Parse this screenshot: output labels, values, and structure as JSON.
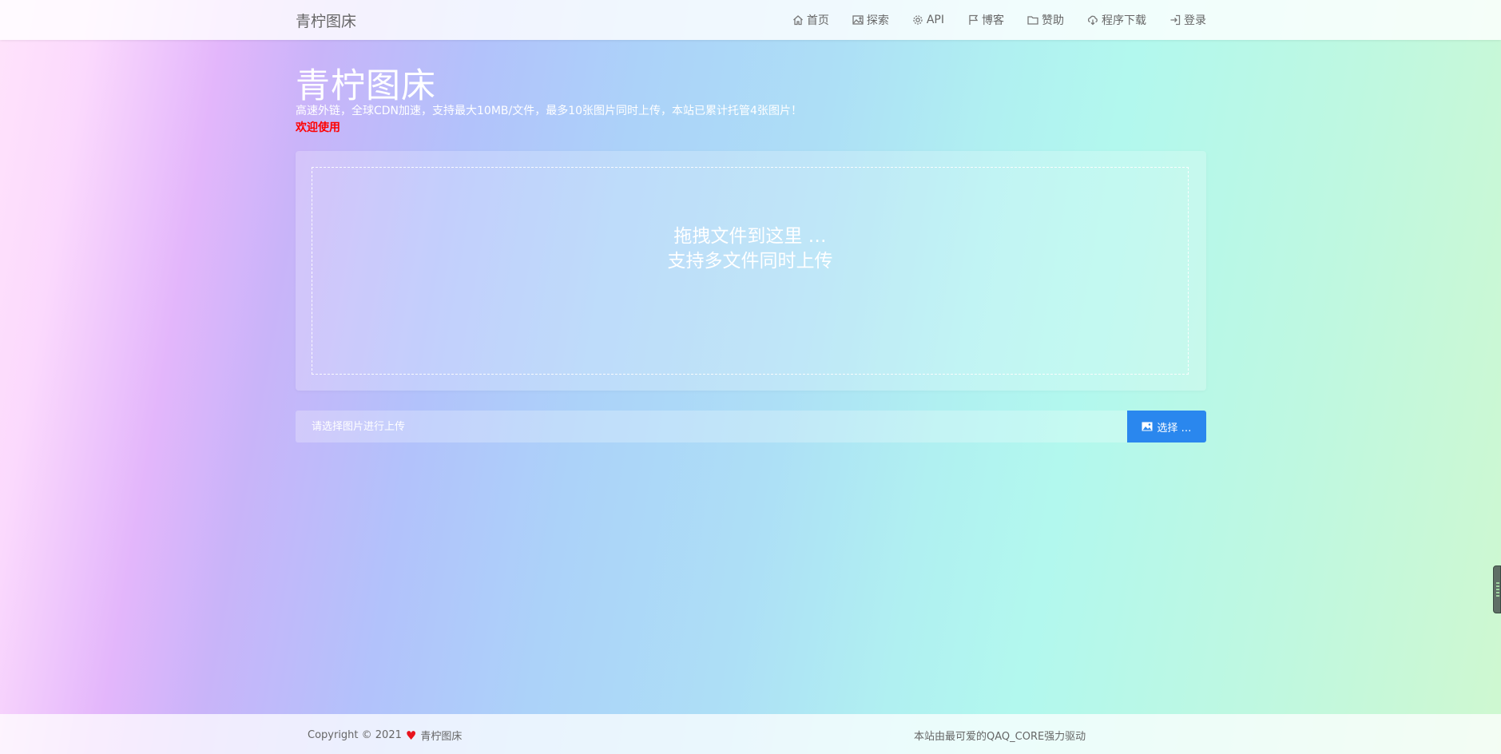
{
  "header": {
    "brand": "青柠图床",
    "nav": [
      {
        "label": "首页",
        "icon": "home-icon"
      },
      {
        "label": "探索",
        "icon": "image-icon"
      },
      {
        "label": "API",
        "icon": "gear-icon"
      },
      {
        "label": "博客",
        "icon": "flag-icon"
      },
      {
        "label": "赞助",
        "icon": "folder-icon"
      },
      {
        "label": "程序下载",
        "icon": "cloud-download-icon"
      },
      {
        "label": "登录",
        "icon": "sign-in-icon"
      }
    ]
  },
  "hero": {
    "title": "青柠图床",
    "subtitle": "高速外链，全球CDN加速，支持最大10MB/文件，最多10张图片同时上传，本站已累计托管4张图片！",
    "welcome": "欢迎使用"
  },
  "dropzone": {
    "line1": "拖拽文件到这里 …",
    "line2": "支持多文件同时上传"
  },
  "upload": {
    "placeholder": "请选择图片进行上传",
    "choose_label": "选择 …",
    "choose_icon": "picture-icon"
  },
  "footer": {
    "copyright_prefix": "Copyright © 2021",
    "heart": "♥",
    "site_name": "青柠图床",
    "powered_by": "本站由最可爱的QAQ_CORE强力驱动"
  },
  "colors": {
    "accent": "#2a87ee",
    "welcome": "#ff0000",
    "heart": "#e8131d"
  }
}
